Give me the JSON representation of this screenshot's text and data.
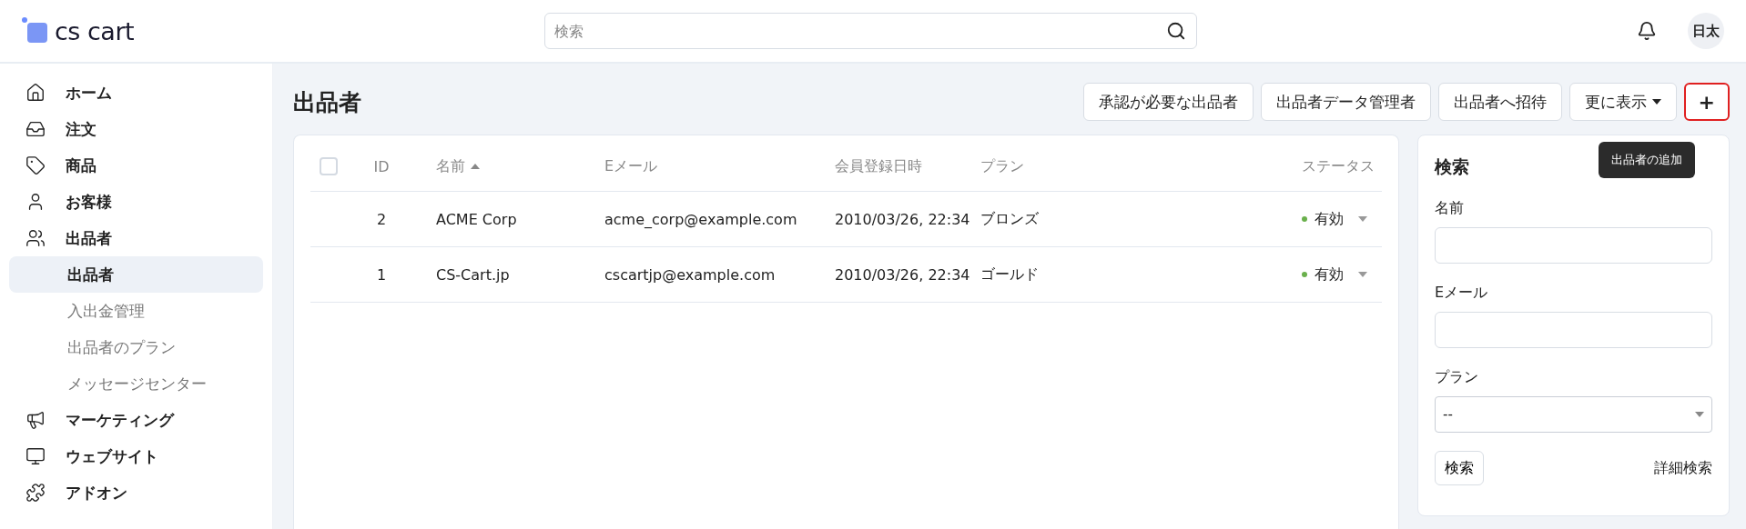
{
  "header": {
    "logo": "cs cart",
    "search": {
      "placeholder": "検索"
    },
    "user_avatar": "日太"
  },
  "sidebar": {
    "items": [
      {
        "label": "ホーム",
        "selected": false
      },
      {
        "label": "注文",
        "selected": false
      },
      {
        "label": "商品",
        "selected": false
      },
      {
        "label": "お客様",
        "selected": false
      },
      {
        "label": "出品者",
        "selected": false,
        "children": [
          {
            "label": "出品者",
            "selected": true
          },
          {
            "label": "入出金管理",
            "selected": false
          },
          {
            "label": "出品者のプラン",
            "selected": false
          },
          {
            "label": "メッセージセンター",
            "selected": false
          }
        ]
      },
      {
        "label": "マーケティング",
        "selected": false
      },
      {
        "label": "ウェブサイト",
        "selected": false
      },
      {
        "label": "アドオン",
        "selected": false
      }
    ]
  },
  "page": {
    "title": "出品者",
    "toolbar": [
      {
        "label": "承認が必要な出品者",
        "kind": "text",
        "highlighted": false
      },
      {
        "label": "出品者データ管理者",
        "kind": "text",
        "highlighted": false
      },
      {
        "label": "出品者へ招待",
        "kind": "text",
        "highlighted": false
      },
      {
        "label": "更に表示",
        "kind": "dropdown",
        "highlighted": false
      },
      {
        "label": "+",
        "kind": "icon",
        "highlighted": true
      }
    ],
    "tooltip": "出品者の追加"
  },
  "table": {
    "select_all": {
      "checked": false
    },
    "columns": [
      {
        "label": "ID",
        "sorted": false
      },
      {
        "label": "名前",
        "sorted": true
      },
      {
        "label": "Eメール",
        "sorted": false
      },
      {
        "label": "会員登録日時",
        "sorted": false
      },
      {
        "label": "プラン",
        "sorted": false
      },
      {
        "label": "ステータス",
        "sorted": false
      }
    ],
    "rows": [
      {
        "id": "2",
        "name": "ACME Corp",
        "email": "acme_corp@example.com",
        "registered": "2010/03/26, 22:34",
        "plan": "ブロンズ",
        "status": "有効",
        "color": "#6ab04c"
      },
      {
        "id": "1",
        "name": "CS-Cart.jp",
        "email": "cscartjp@example.com",
        "registered": "2010/03/26, 22:34",
        "plan": "ゴールド",
        "status": "有効",
        "color": "#6ab04c"
      }
    ]
  },
  "search_panel": {
    "title": "検索",
    "fields": [
      {
        "label": "名前",
        "kind": "text"
      },
      {
        "label": "Eメール",
        "kind": "text"
      },
      {
        "label": "プラン",
        "kind": "select",
        "value": "--"
      }
    ],
    "submit": "検索",
    "advanced": "詳細検索"
  }
}
